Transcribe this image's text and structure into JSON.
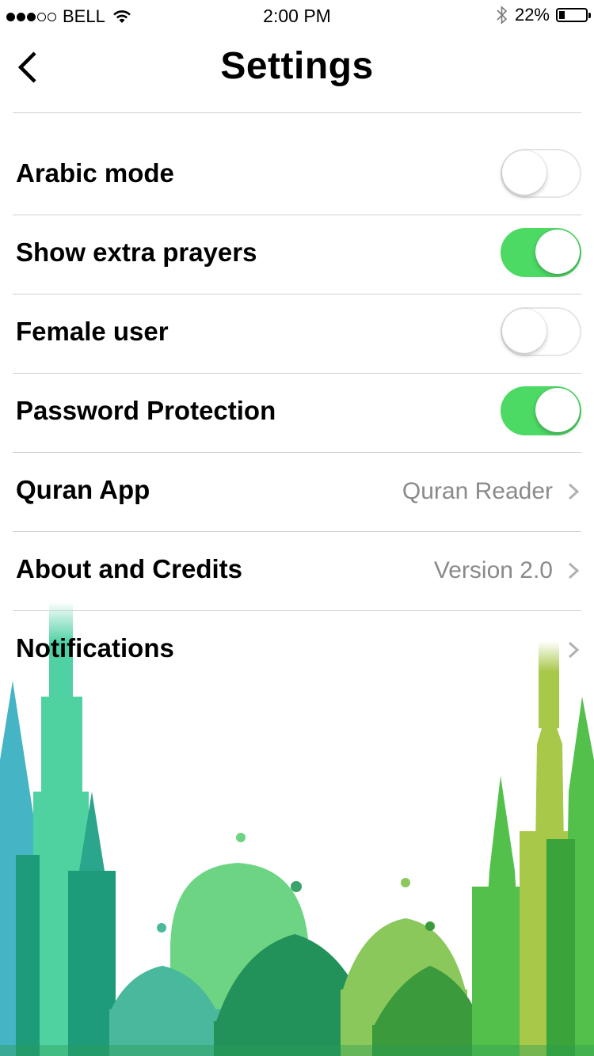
{
  "status": {
    "carrier": "BELL",
    "time": "2:00 PM",
    "battery_pct_label": "22%",
    "battery_fraction": 0.22,
    "signal_bars_filled": 3,
    "signal_bars_total": 5
  },
  "nav": {
    "title": "Settings",
    "back_icon": "chevron-left-icon"
  },
  "rows": [
    {
      "label": "Arabic mode",
      "type": "toggle",
      "on": false
    },
    {
      "label": "Show extra prayers",
      "type": "toggle",
      "on": true
    },
    {
      "label": "Female user",
      "type": "toggle",
      "on": false
    },
    {
      "label": "Password Protection",
      "type": "toggle",
      "on": true
    },
    {
      "label": "Quran App",
      "type": "link",
      "detail": "Quran Reader"
    },
    {
      "label": "About and Credits",
      "type": "link",
      "detail": "Version 2.0"
    },
    {
      "label": "Notifications",
      "type": "link",
      "detail": ""
    }
  ],
  "colors": {
    "toggle_on": "#4cd964",
    "separator": "#cfcfcf",
    "detail_text": "#8a8a8a",
    "chevron": "#b0b0b0"
  },
  "decoration": {
    "background_art": "mosque-skyline-illustration"
  }
}
